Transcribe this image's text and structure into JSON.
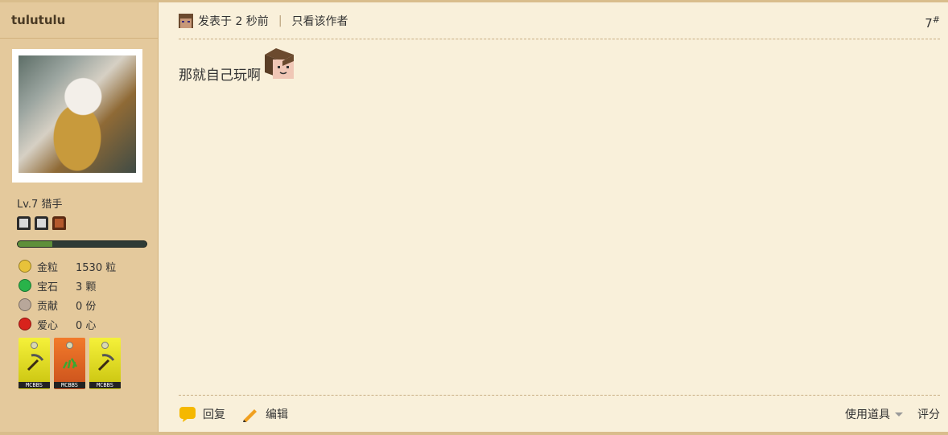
{
  "user": {
    "name": "tulutulu",
    "level": "Lv.7 猎手",
    "progress": 0.27
  },
  "stats": [
    {
      "label": "金粒",
      "value": "1530 粒",
      "icon": "gold-nugget-icon",
      "color": "#e8c23a"
    },
    {
      "label": "宝石",
      "value": "3 颗",
      "icon": "emerald-icon",
      "color": "#29b34a"
    },
    {
      "label": "贡献",
      "value": "0 份",
      "icon": "contribution-icon",
      "color": "#b8a79a"
    },
    {
      "label": "爱心",
      "value": "0 心",
      "icon": "apple-heart-icon",
      "color": "#d8231c"
    }
  ],
  "medals": [
    {
      "label": "MCBBS",
      "color": "yellow"
    },
    {
      "label": "MCBBS",
      "color": "orange"
    },
    {
      "label": "MCBBS",
      "color": "yellow"
    }
  ],
  "post": {
    "posted": "发表于 2 秒前",
    "only_author": "只看该作者",
    "separator": "|",
    "floor": "7",
    "floor_mark": "#",
    "content": "那就自己玩啊"
  },
  "footer": {
    "reply": "回复",
    "edit": "编辑",
    "use_tools": "使用道具",
    "rate": "评分"
  }
}
